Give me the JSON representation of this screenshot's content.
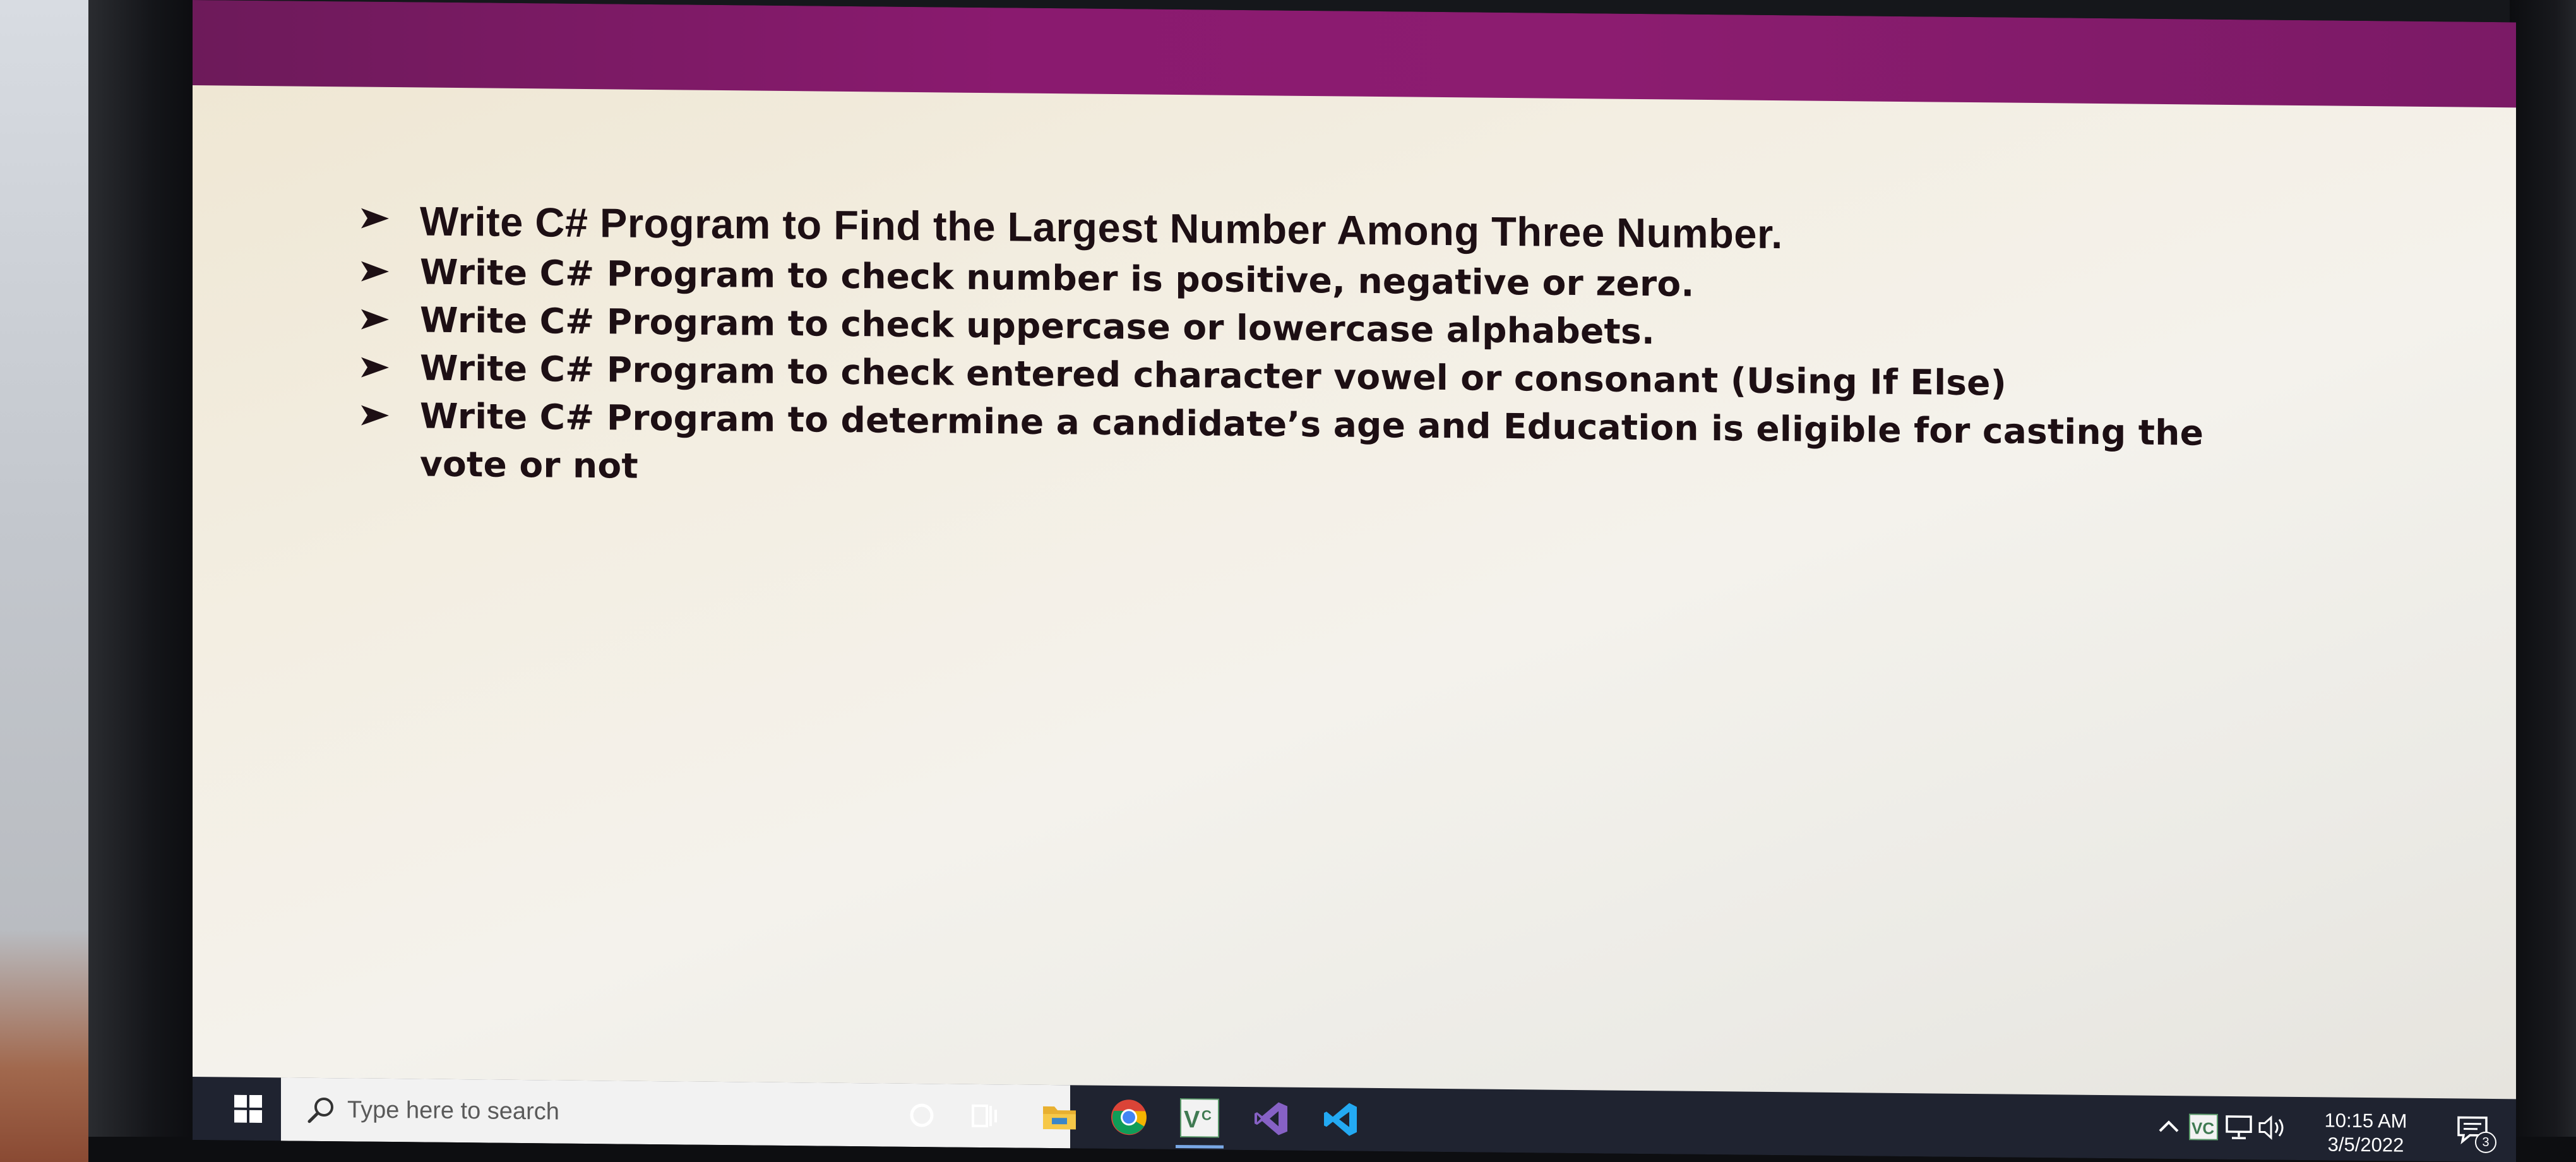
{
  "slide": {
    "bullets": [
      "Write C# Program to Find the Largest Number Among Three Number.",
      "Write C# Program to check number is positive, negative or zero.",
      "Write C# Program to check uppercase or lowercase alphabets.",
      "Write C# Program to check entered character vowel or consonant (Using If Else)",
      "Write C# Program to determine a candidate’s age and Education is eligible for casting the vote or not"
    ]
  },
  "taskbar": {
    "search_placeholder": "Type here to search",
    "pinned_apps": [
      {
        "icon": "cortana-circle-icon"
      },
      {
        "icon": "task-view-icon"
      },
      {
        "icon": "file-explorer-icon"
      },
      {
        "icon": "chrome-icon"
      },
      {
        "icon": "vc-app-icon",
        "label": "VC",
        "active": true
      },
      {
        "icon": "visual-studio-icon"
      },
      {
        "icon": "vscode-icon"
      }
    ],
    "tray": {
      "clock_time": "10:15 AM",
      "clock_date": "3/5/2022",
      "notification_count": "3",
      "tray_app_label": "VC"
    }
  },
  "colors": {
    "title_strip": "#8a1a6f",
    "slide_background": "#f3eee2",
    "bullet_text": "#1d0f14",
    "taskbar": "#1f2330"
  }
}
